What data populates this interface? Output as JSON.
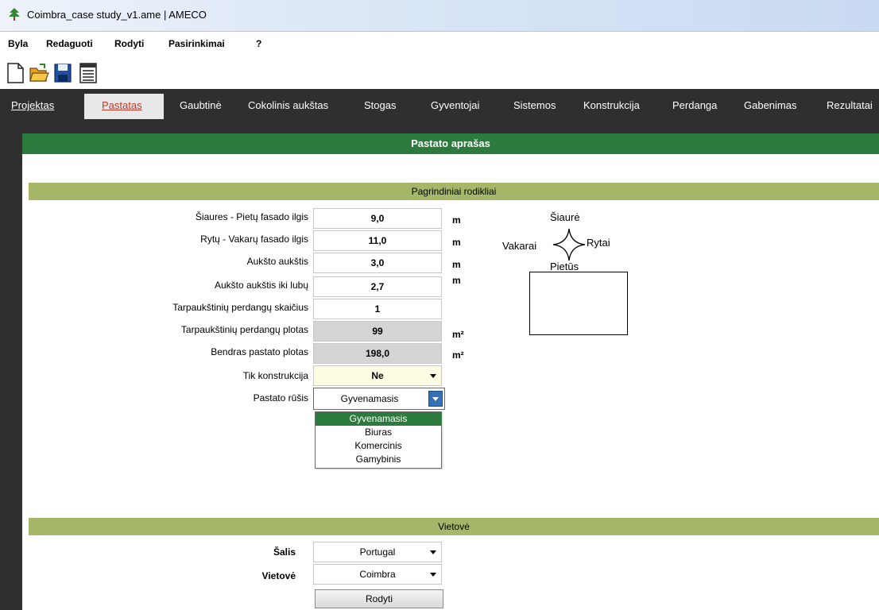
{
  "window": {
    "title": "Coimbra_case study_v1.ame | AMECO"
  },
  "menu": {
    "items": [
      "Byla",
      "Redaguoti",
      "Rodyti",
      "Pasirinkimai",
      "?"
    ]
  },
  "toolbar": {
    "icons": [
      "new-file-icon",
      "open-folder-icon",
      "save-icon",
      "report-icon"
    ]
  },
  "tabs": {
    "items": [
      "Projektas",
      "Pastatas",
      "Gaubtinė",
      "Cokolinis aukštas",
      "Stogas",
      "Gyventojai",
      "Sistemos",
      "Konstrukcija",
      "Perdanga",
      "Gabenimas",
      "Rezultatai"
    ],
    "active": "Pastatas"
  },
  "main": {
    "header": "Pastato aprašas",
    "basic_section": "Pagrindiniai rodikliai",
    "location_section": "Vietovė"
  },
  "fields": {
    "ns_length": {
      "label": "Šiaures - Pietų fasado ilgis",
      "value": "9,0",
      "unit": "m"
    },
    "ew_length": {
      "label": "Rytų - Vakarų fasado ilgis",
      "value": "11,0",
      "unit": "m"
    },
    "floor_height": {
      "label": "Aukšto aukštis",
      "value": "3,0",
      "unit": "m"
    },
    "ceiling_height": {
      "label": "Aukšto aukštis iki lubų",
      "value": "2,7",
      "unit": "m"
    },
    "floor_count": {
      "label": "Tarpaukštinių perdangų skaičius",
      "value": "1"
    },
    "floor_area": {
      "label": "Tarpaukštinių perdangų plotas",
      "value": "99",
      "unit": "m²"
    },
    "total_area": {
      "label": "Bendras pastato plotas",
      "value": "198,0",
      "unit": "m²"
    },
    "structure_only": {
      "label": "Tik konstrukcija",
      "value": "Ne"
    },
    "building_type": {
      "label": "Pastato rūšis",
      "value": "Gyvenamasis",
      "options": [
        "Gyvenamasis",
        "Biuras",
        "Komercinis",
        "Gamybinis"
      ]
    }
  },
  "compass": {
    "north": "Šiaurė",
    "south": "Pietūs",
    "west": "Vakarai",
    "east": "Rytai"
  },
  "location": {
    "country": {
      "label": "Šalis",
      "value": "Portugal"
    },
    "place": {
      "label": "Vietovė",
      "value": "Coimbra"
    },
    "show_button": "Rodyti"
  },
  "colors": {
    "header_green": "#2d7a3e",
    "band_olive": "#a5b86a",
    "dark_frame": "#2f2f2f",
    "active_tab": "#c0392b"
  }
}
